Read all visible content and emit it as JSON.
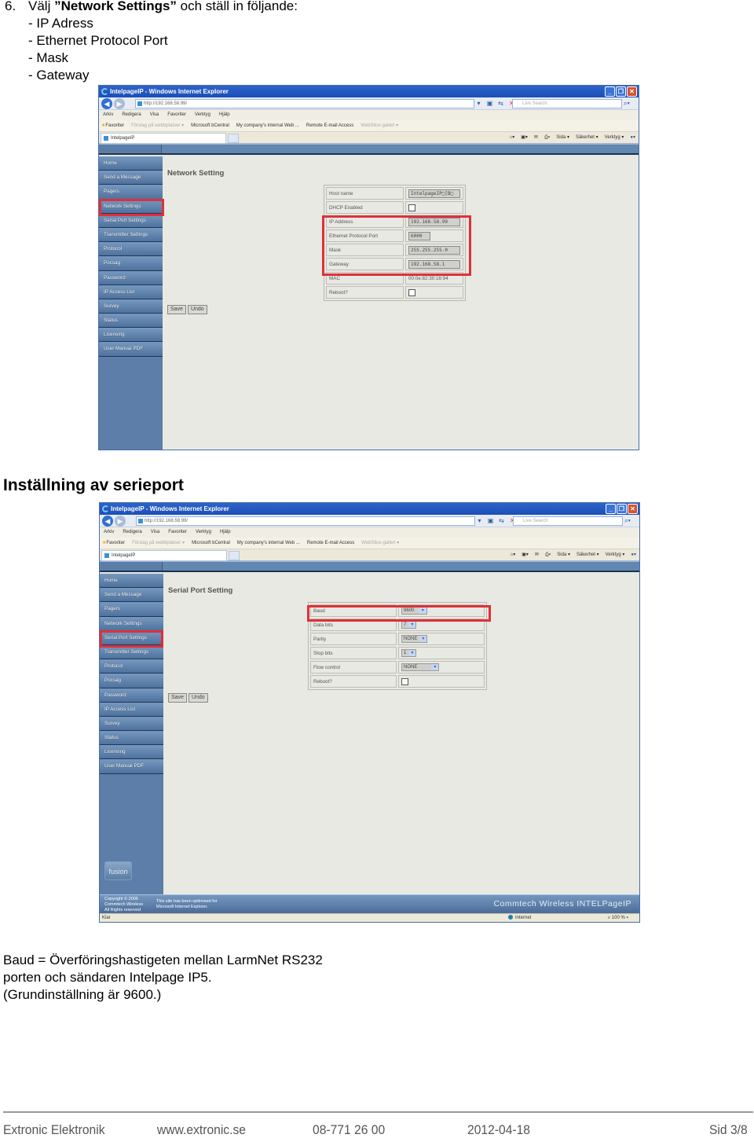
{
  "instructions": {
    "step_number": "6.",
    "lead_pre": "Välj ",
    "lead_bold": "”Network Settings”",
    "lead_post": " och ställ in följande:",
    "items": [
      "- IP Adress",
      "- Ethernet Protocol Port",
      "- Mask",
      "- Gateway"
    ]
  },
  "browser": {
    "title": "IntelpageIP - Windows Internet Explorer",
    "address": "http://192.168.58.99/",
    "search_placeholder": "Live Search",
    "menu": [
      "Arkiv",
      "Redigera",
      "Visa",
      "Favoriter",
      "Verktyg",
      "Hjälp"
    ],
    "favorites": [
      "Favoriter",
      "Förslag på webbplatser ▾",
      "Microsoft bCentral",
      "My company's internal Web ...",
      "Remote E-mail Access",
      "WebSlice-galleri ▾"
    ],
    "tab_label": "IntelpageIP",
    "command_bar": [
      "Sida ▾",
      "Säkerhet ▾",
      "Verktyg ▾"
    ]
  },
  "nav_items": [
    "Home",
    "Send a Message",
    "Pagers",
    "Network Settings",
    "Serial Port Settings",
    "Transmitter Settings",
    "Protocol",
    "Pocsag",
    "Password",
    "IP Access List",
    "Survey",
    "Status",
    "Licensing",
    "User Manual PDF"
  ],
  "network_screen": {
    "page_title": "Network Setting",
    "highlighted_nav": "Network Settings",
    "fields": {
      "host_name": {
        "label": "Host name",
        "value": "IntelpageIP□[B□"
      },
      "dhcp": {
        "label": "DHCP Enabled",
        "checked": false
      },
      "ip": {
        "label": "IP Address",
        "value": "192.168.58.99"
      },
      "port": {
        "label": "Ethernet Protocol Port",
        "value": "6000"
      },
      "mask": {
        "label": "Mask",
        "value": "255.255.255.0"
      },
      "gateway": {
        "label": "Gateway",
        "value": "192.168.58.1"
      },
      "mac": {
        "label": "MAC",
        "value": "00:0e:82:30:16:94"
      },
      "reboot": {
        "label": "Reboot?",
        "checked": false
      }
    },
    "save_label": "Save",
    "undo_label": "Undo"
  },
  "section_heading": "Inställning av serieport",
  "serial_screen": {
    "page_title": "Serial Port Setting",
    "highlighted_nav": "Serial Port Settings",
    "fields": {
      "baud": {
        "label": "Baud",
        "value": "9600"
      },
      "data_bits": {
        "label": "Data bits",
        "value": "7"
      },
      "parity": {
        "label": "Parity",
        "value": "NONE"
      },
      "stop_bits": {
        "label": "Stop bits",
        "value": "1"
      },
      "flow": {
        "label": "Flow control",
        "value": "NONE"
      },
      "reboot": {
        "label": "Reboot?",
        "checked": false
      }
    },
    "save_label": "Save",
    "undo_label": "Undo",
    "logo": "fusion",
    "copyright": [
      "Copyright © 2006",
      "Commtech Wireless",
      "All Rights reserved"
    ],
    "optimized": [
      "This site has been optimised for",
      "Microsoft Internet Explorer."
    ],
    "brand": "Commtech Wireless INTELPageIP",
    "status_left": "Klar",
    "status_zone": "Internet",
    "status_zoom": "100 %"
  },
  "note": [
    "Baud = Överföringshastigeten mellan LarmNet RS232",
    "porten och sändaren Intelpage IP5.",
    "(Grundinställning är 9600.)"
  ],
  "footer": {
    "company": "Extronic Elektronik",
    "website": "www.extronic.se",
    "phone": "08-771 26 00",
    "date": "2012-04-18",
    "page": "Sid 3/8"
  }
}
